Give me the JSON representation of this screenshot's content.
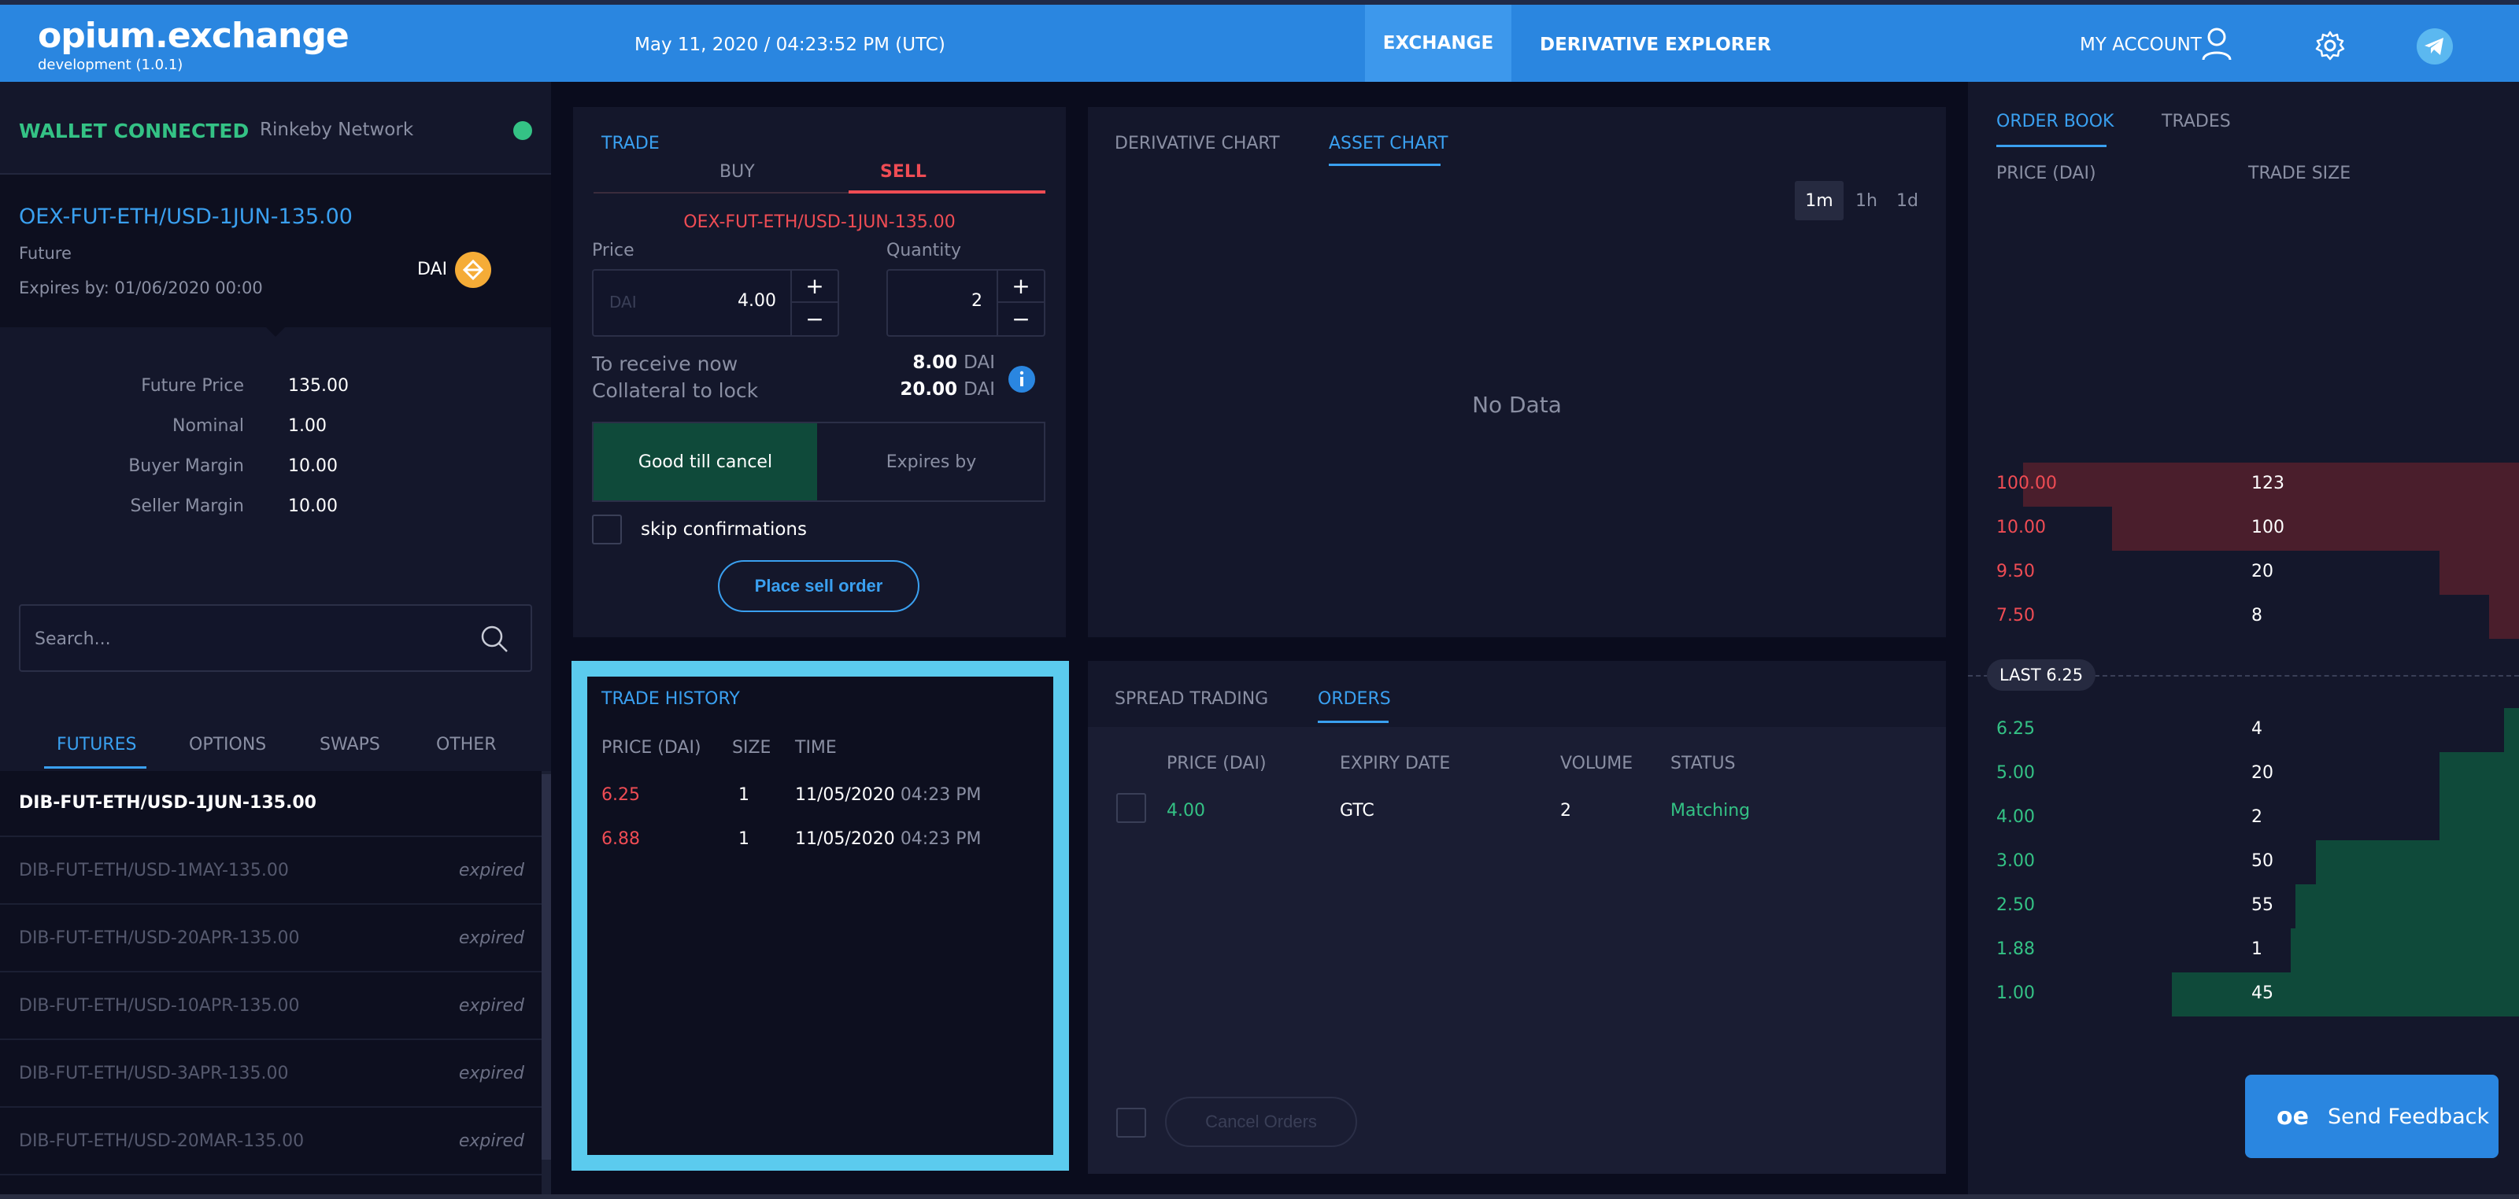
{
  "header": {
    "logo": "opium.exchange",
    "version": "development (1.0.1)",
    "datetime": "May 11, 2020 / 04:23:52 PM (UTC)",
    "nav_exchange": "EXCHANGE",
    "nav_derivative_explorer": "DERIVATIVE EXPLORER",
    "my_account": "MY ACCOUNT"
  },
  "wallet": {
    "status": "WALLET CONNECTED",
    "network": "Rinkeby Network",
    "status_color": "#34c285"
  },
  "derivative": {
    "name": "OEX-FUT-ETH/USD-1JUN-135.00",
    "type": "Future",
    "expires": "Expires by: 01/06/2020 00:00",
    "currency": "DAI"
  },
  "specs": [
    {
      "label": "Future Price",
      "value": "135.00"
    },
    {
      "label": "Nominal",
      "value": "1.00"
    },
    {
      "label": "Buyer Margin",
      "value": "10.00"
    },
    {
      "label": "Seller Margin",
      "value": "10.00"
    }
  ],
  "search": {
    "placeholder": "Search..."
  },
  "categories": [
    "FUTURES",
    "OPTIONS",
    "SWAPS",
    "OTHER"
  ],
  "derivative_list": [
    {
      "name": "DIB-FUT-ETH/USD-1JUN-135.00",
      "status": ""
    },
    {
      "name": "DIB-FUT-ETH/USD-1MAY-135.00",
      "status": "expired"
    },
    {
      "name": "DIB-FUT-ETH/USD-20APR-135.00",
      "status": "expired"
    },
    {
      "name": "DIB-FUT-ETH/USD-10APR-135.00",
      "status": "expired"
    },
    {
      "name": "DIB-FUT-ETH/USD-3APR-135.00",
      "status": "expired"
    },
    {
      "name": "DIB-FUT-ETH/USD-20MAR-135.00",
      "status": "expired"
    }
  ],
  "trade": {
    "title": "TRADE",
    "buy_label": "BUY",
    "sell_label": "SELL",
    "derivative": "OEX-FUT-ETH/USD-1JUN-135.00",
    "price_label": "Price",
    "price_placeholder": "DAI",
    "price_value": "4.00",
    "quantity_label": "Quantity",
    "quantity_value": "2",
    "receive_label": "To receive now",
    "receive_value": "8.00",
    "collateral_label": "Collateral to lock",
    "collateral_value": "20.00",
    "unit": "DAI",
    "gtc_label": "Good till cancel",
    "expires_label": "Expires by",
    "skip_label": "skip confirmations",
    "place_button": "Place sell order",
    "sell_color": "#ef4c54"
  },
  "chart": {
    "tab_derivative": "DERIVATIVE CHART",
    "tab_asset": "ASSET CHART",
    "timeframes": [
      "1m",
      "1h",
      "1d"
    ],
    "no_data": "No Data"
  },
  "history": {
    "title": "TRADE HISTORY",
    "headers": [
      "PRICE (DAI)",
      "SIZE",
      "TIME"
    ],
    "rows": [
      {
        "price": "6.25",
        "size": "1",
        "date": "11/05/2020",
        "time": "04:23 PM"
      },
      {
        "price": "6.88",
        "size": "1",
        "date": "11/05/2020",
        "time": "04:23 PM"
      }
    ]
  },
  "orders": {
    "tab_spread": "SPREAD TRADING",
    "tab_orders": "ORDERS",
    "headers": [
      "PRICE (DAI)",
      "EXPIRY DATE",
      "VOLUME",
      "STATUS"
    ],
    "rows": [
      {
        "price": "4.00",
        "expiry": "GTC",
        "volume": "2",
        "status": "Matching"
      }
    ],
    "cancel_button": "Cancel Orders"
  },
  "order_book": {
    "tab_book": "ORDER BOOK",
    "tab_trades": "TRADES",
    "headers": [
      "PRICE (DAI)",
      "TRADE SIZE"
    ],
    "asks": [
      {
        "price": "100.00",
        "size": "123",
        "fill": 1.0
      },
      {
        "price": "10.00",
        "size": "100",
        "fill": 0.82
      },
      {
        "price": "9.50",
        "size": "20",
        "fill": 0.16
      },
      {
        "price": "7.50",
        "size": "8",
        "fill": 0.06
      }
    ],
    "last": "LAST 6.25",
    "bids": [
      {
        "price": "6.25",
        "size": "4",
        "fill": 0.03
      },
      {
        "price": "5.00",
        "size": "20",
        "fill": 0.16
      },
      {
        "price": "4.00",
        "size": "2",
        "fill": 0.16
      },
      {
        "price": "3.00",
        "size": "50",
        "fill": 0.41
      },
      {
        "price": "2.50",
        "size": "55",
        "fill": 0.45
      },
      {
        "price": "1.88",
        "size": "1",
        "fill": 0.46
      },
      {
        "price": "1.00",
        "size": "45",
        "fill": 0.7
      }
    ]
  },
  "feedback": {
    "logo": "oe",
    "label": "Send Feedback"
  }
}
